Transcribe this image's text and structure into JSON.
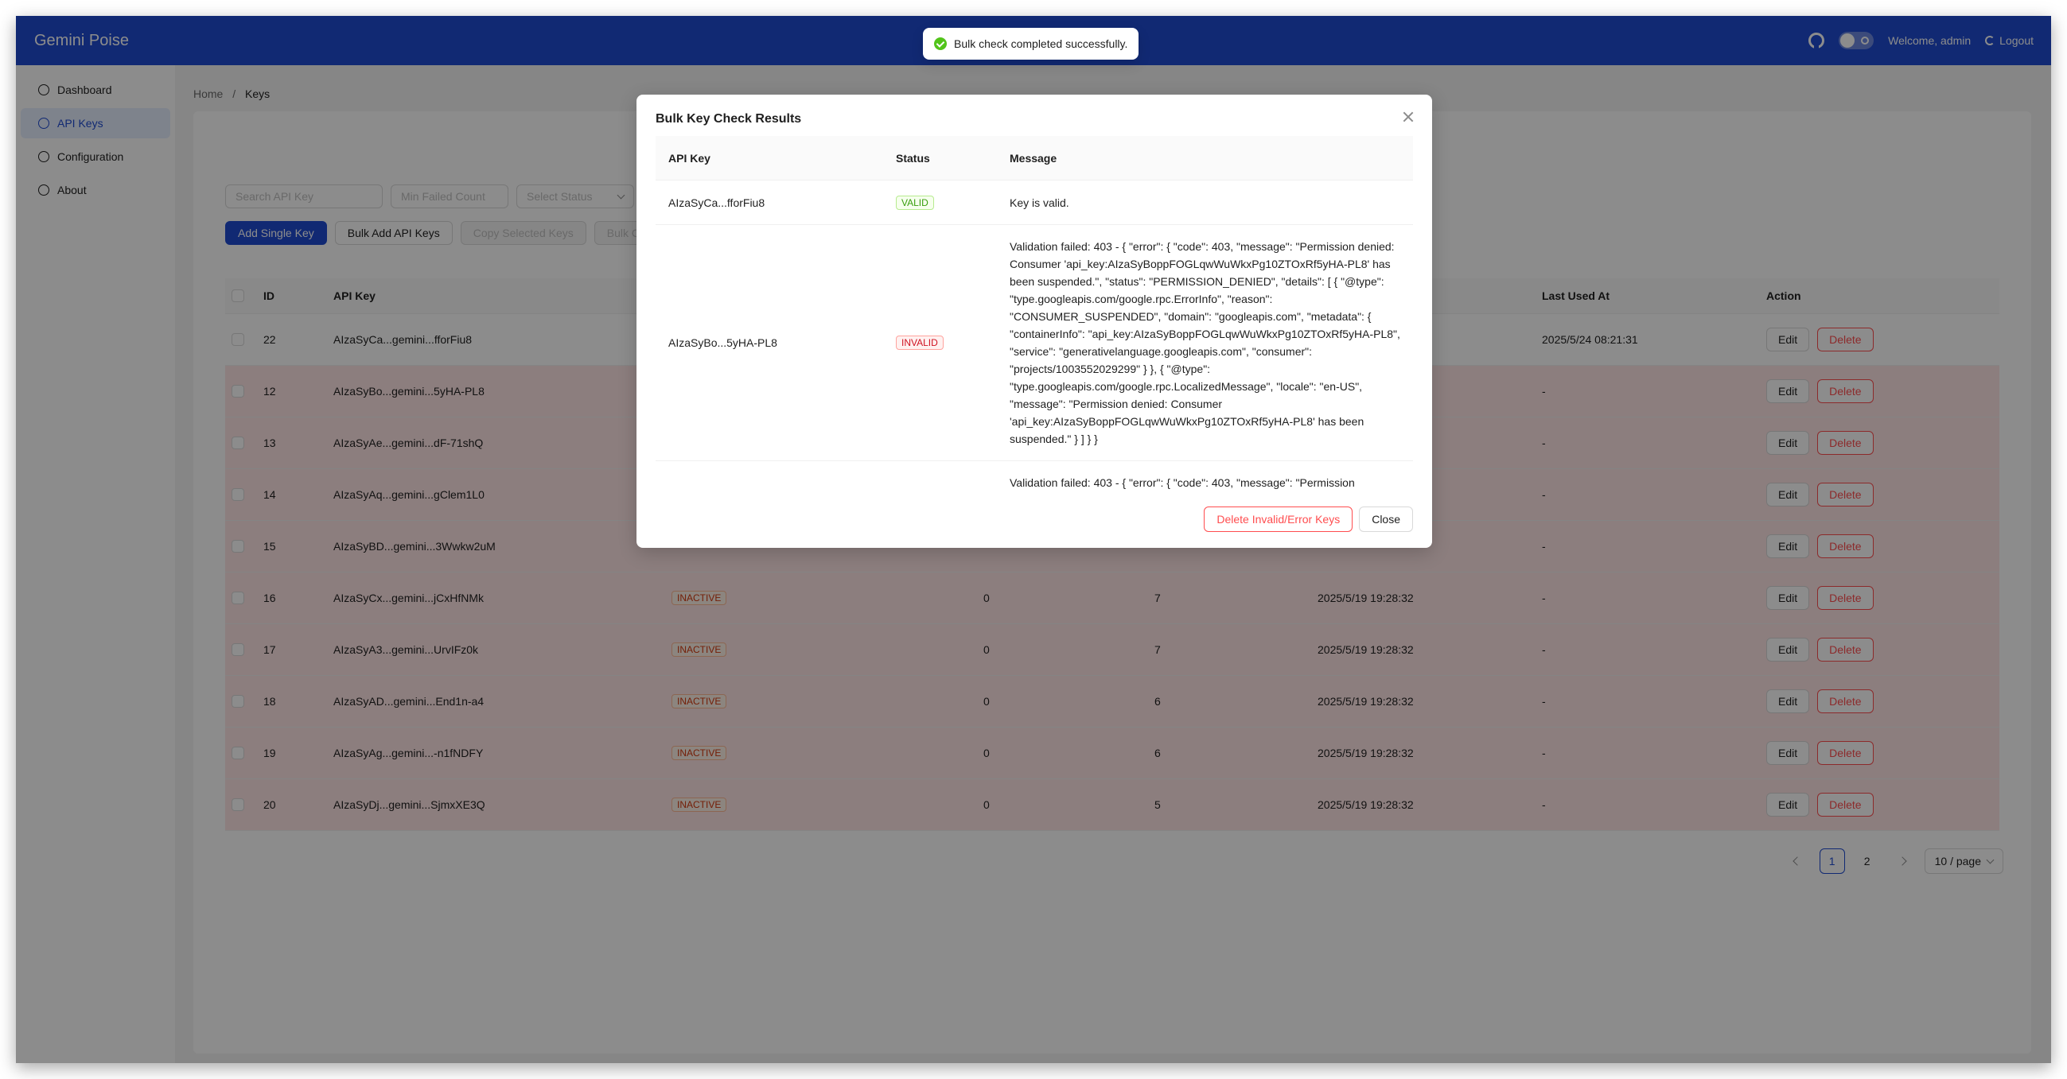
{
  "app": {
    "brand": "Gemini Poise",
    "welcome": "Welcome, admin",
    "logout": "Logout"
  },
  "sidebar": {
    "items": [
      {
        "label": "Dashboard",
        "icon": "dashboard-icon"
      },
      {
        "label": "API Keys",
        "icon": "key-icon"
      },
      {
        "label": "Configuration",
        "icon": "gear-icon"
      },
      {
        "label": "About",
        "icon": "info-icon"
      }
    ]
  },
  "breadcrumb": {
    "home": "Home",
    "sep": "/",
    "current": "Keys"
  },
  "filters": {
    "search_placeholder": "Search API Key",
    "min_failed_placeholder": "Min Failed Count",
    "status_placeholder": "Select Status"
  },
  "actions": {
    "add_single": "Add Single Key",
    "bulk_add": "Bulk Add API Keys",
    "copy_selected": "Copy Selected Keys",
    "bulk_check": "Bulk C"
  },
  "table": {
    "headers": {
      "id": "ID",
      "key": "API Key",
      "last_used": "Last Used At",
      "action": "Action"
    },
    "rows": [
      {
        "id": "22",
        "key": "AIzaSyCa...gemini...fforFiu8",
        "status": "",
        "failed": "",
        "usage": "",
        "created": "",
        "last": "2025/5/24 08:21:31"
      },
      {
        "id": "12",
        "key": "AIzaSyBo...gemini...5yHA-PL8",
        "status": "",
        "failed": "",
        "usage": "",
        "created": "",
        "last": "-"
      },
      {
        "id": "13",
        "key": "AIzaSyAe...gemini...dF-71shQ",
        "status": "",
        "failed": "",
        "usage": "",
        "created": "",
        "last": "-"
      },
      {
        "id": "14",
        "key": "AIzaSyAq...gemini...gClem1L0",
        "status": "",
        "failed": "",
        "usage": "",
        "created": "",
        "last": "-"
      },
      {
        "id": "15",
        "key": "AIzaSyBD...gemini...3Wwkw2uM",
        "status": "",
        "failed": "",
        "usage": "",
        "created": "",
        "last": "-"
      },
      {
        "id": "16",
        "key": "AIzaSyCx...gemini...jCxHfNMk",
        "status": "INACTIVE",
        "failed": "0",
        "usage": "7",
        "created": "2025/5/19 19:28:32",
        "last": "-"
      },
      {
        "id": "17",
        "key": "AIzaSyA3...gemini...UrvIFz0k",
        "status": "INACTIVE",
        "failed": "0",
        "usage": "7",
        "created": "2025/5/19 19:28:32",
        "last": "-"
      },
      {
        "id": "18",
        "key": "AIzaSyAD...gemini...End1n-a4",
        "status": "INACTIVE",
        "failed": "0",
        "usage": "6",
        "created": "2025/5/19 19:28:32",
        "last": "-"
      },
      {
        "id": "19",
        "key": "AIzaSyAg...gemini...-n1fNDFY",
        "status": "INACTIVE",
        "failed": "0",
        "usage": "6",
        "created": "2025/5/19 19:28:32",
        "last": "-"
      },
      {
        "id": "20",
        "key": "AIzaSyDj...gemini...SjmxXE3Q",
        "status": "INACTIVE",
        "failed": "0",
        "usage": "5",
        "created": "2025/5/19 19:28:32",
        "last": "-"
      }
    ],
    "edit": "Edit",
    "delete": "Delete"
  },
  "pagination": {
    "pages": [
      "1",
      "2"
    ],
    "current": "1",
    "page_size": "10 / page"
  },
  "toast": {
    "message": "Bulk check completed successfully."
  },
  "modal": {
    "title": "Bulk Key Check Results",
    "headers": {
      "key": "API Key",
      "status": "Status",
      "message": "Message"
    },
    "rows": [
      {
        "key": "AIzaSyCa...fforFiu8",
        "status": "VALID",
        "message": "Key is valid."
      },
      {
        "key": "AIzaSyBo...5yHA-PL8",
        "status": "INVALID",
        "message": "Validation failed: 403 - { \"error\": { \"code\": 403, \"message\": \"Permission denied: Consumer 'api_key:AIzaSyBoppFOGLqwWuWkxPg10ZTOxRf5yHA-PL8' has been suspended.\", \"status\": \"PERMISSION_DENIED\", \"details\": [ { \"@type\": \"type.googleapis.com/google.rpc.ErrorInfo\", \"reason\": \"CONSUMER_SUSPENDED\", \"domain\": \"googleapis.com\", \"metadata\": { \"containerInfo\": \"api_key:AIzaSyBoppFOGLqwWuWkxPg10ZTOxRf5yHA-PL8\", \"service\": \"generativelanguage.googleapis.com\", \"consumer\": \"projects/1003552029299\" } }, { \"@type\": \"type.googleapis.com/google.rpc.LocalizedMessage\", \"locale\": \"en-US\", \"message\": \"Permission denied: Consumer 'api_key:AIzaSyBoppFOGLqwWuWkxPg10ZTOxRf5yHA-PL8' has been suspended.\" } ] } }"
      },
      {
        "key": "",
        "status": "",
        "message": "Validation failed: 403 - { \"error\": { \"code\": 403, \"message\": \"Permission"
      }
    ],
    "delete_button": "Delete Invalid/Error Keys",
    "close_button": "Close"
  },
  "colors": {
    "brand": "#1f4bd1",
    "danger": "#ff4d4f",
    "success": "#52c41a",
    "bad_row": "#ffe5e5"
  }
}
